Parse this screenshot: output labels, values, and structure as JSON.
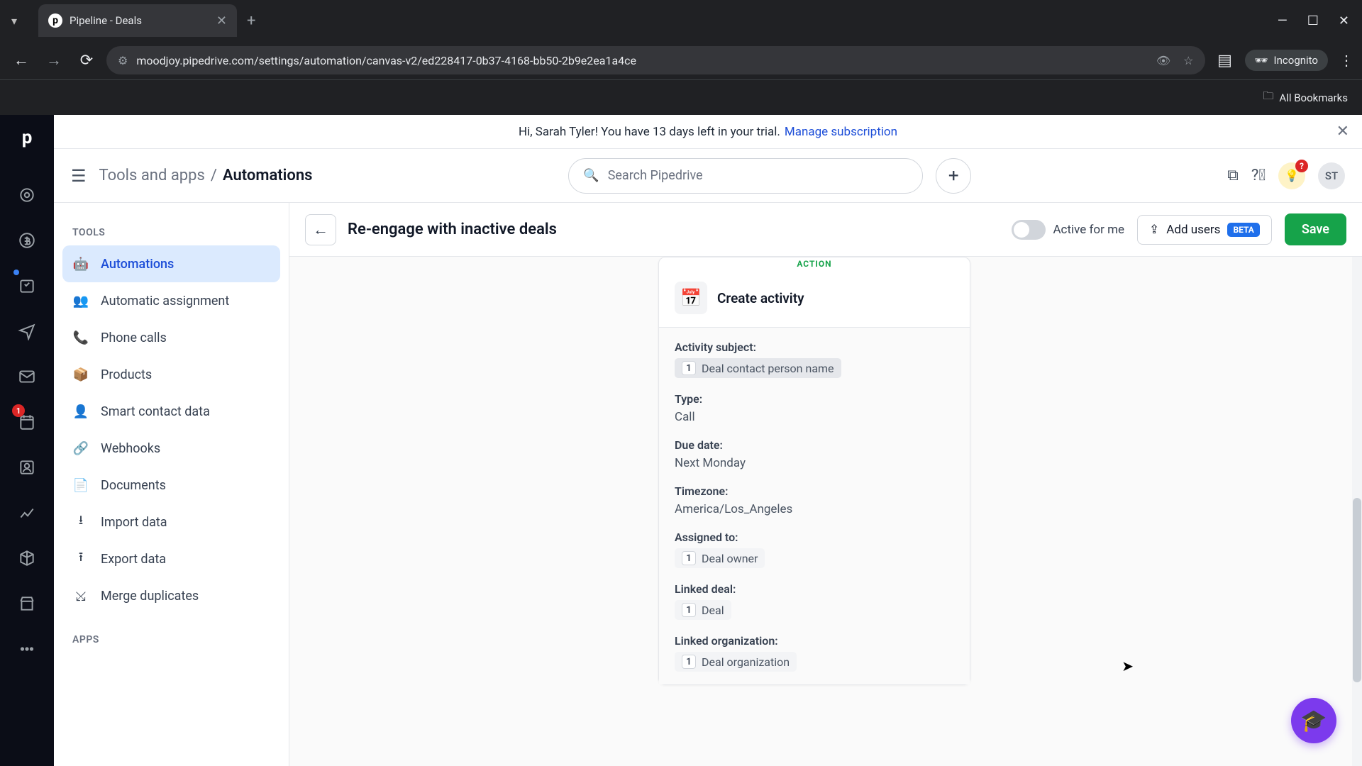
{
  "browser": {
    "tab_title": "Pipeline - Deals",
    "url": "moodjoy.pipedrive.com/settings/automation/canvas-v2/ed228417-0b37-4168-bb50-2b9e2ea1a4ce",
    "incognito": "Incognito",
    "all_bookmarks": "All Bookmarks"
  },
  "banner": {
    "text": "Hi, Sarah Tyler! You have 13 days left in your trial.",
    "link": "Manage subscription"
  },
  "topbar": {
    "breadcrumb_root": "Tools and apps",
    "breadcrumb_current": "Automations",
    "search_placeholder": "Search Pipedrive",
    "avatar": "ST"
  },
  "sidebar": {
    "heading_tools": "TOOLS",
    "heading_apps": "APPS",
    "items": [
      {
        "label": "Automations"
      },
      {
        "label": "Automatic assignment"
      },
      {
        "label": "Phone calls"
      },
      {
        "label": "Products"
      },
      {
        "label": "Smart contact data"
      },
      {
        "label": "Webhooks"
      },
      {
        "label": "Documents"
      },
      {
        "label": "Import data"
      },
      {
        "label": "Export data"
      },
      {
        "label": "Merge duplicates"
      }
    ]
  },
  "canvas": {
    "title": "Re-engage with inactive deals",
    "active_label": "Active for me",
    "add_users": "Add users",
    "beta": "BETA",
    "save": "Save"
  },
  "card": {
    "action_tag": "ACTION",
    "title": "Create activity",
    "fields": {
      "subject_label": "Activity subject:",
      "subject_token_num": "1",
      "subject_token": "Deal contact person name",
      "type_label": "Type:",
      "type_value": "Call",
      "due_label": "Due date:",
      "due_value": "Next Monday",
      "tz_label": "Timezone:",
      "tz_value": "America/Los_Angeles",
      "assigned_label": "Assigned to:",
      "assigned_num": "1",
      "assigned_token": "Deal owner",
      "linked_deal_label": "Linked deal:",
      "linked_deal_num": "1",
      "linked_deal_token": "Deal",
      "linked_org_label": "Linked organization:",
      "linked_org_num": "1",
      "linked_org_token": "Deal organization"
    }
  },
  "rail": {
    "badge": "1"
  }
}
